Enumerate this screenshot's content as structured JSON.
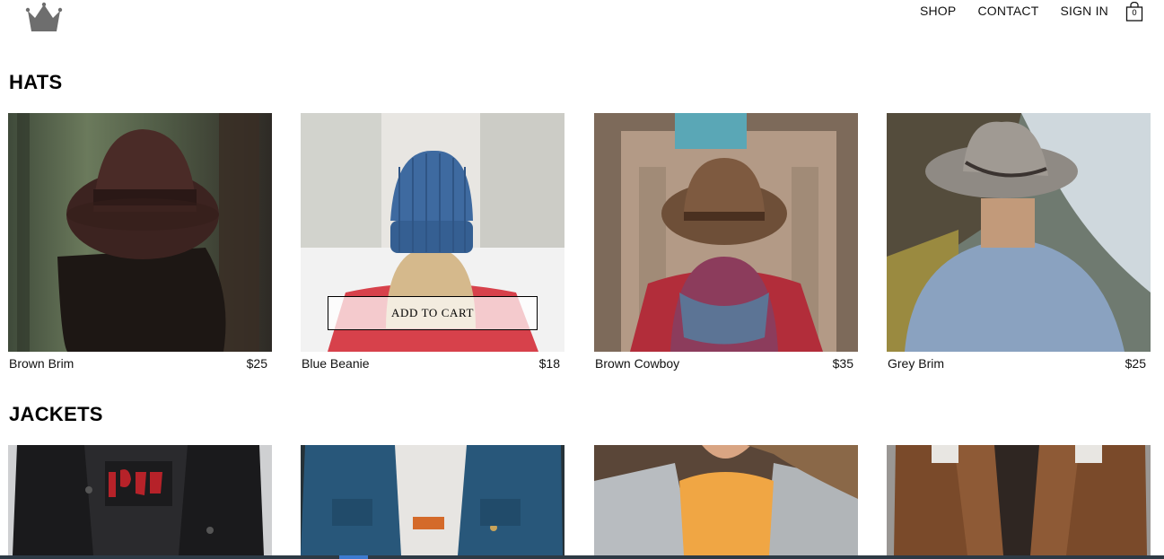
{
  "nav": {
    "shop": "SHOP",
    "contact": "CONTACT",
    "sign_in": "SIGN IN",
    "cart_count": "0"
  },
  "sections": {
    "hats": {
      "title": "HATS",
      "items": [
        {
          "name": "Brown Brim",
          "price": "$25"
        },
        {
          "name": "Blue Beanie",
          "price": "$18"
        },
        {
          "name": "Brown Cowboy",
          "price": "$35"
        },
        {
          "name": "Grey Brim",
          "price": "$25"
        }
      ],
      "add_to_cart": "ADD TO CART"
    },
    "jackets": {
      "title": "JACKETS"
    }
  },
  "colors": {
    "logo": "#6e6e6e",
    "text": "#111111",
    "button_border": "#000000"
  },
  "icons": {
    "logo": "crown-icon",
    "cart": "shopping-bag-icon"
  }
}
